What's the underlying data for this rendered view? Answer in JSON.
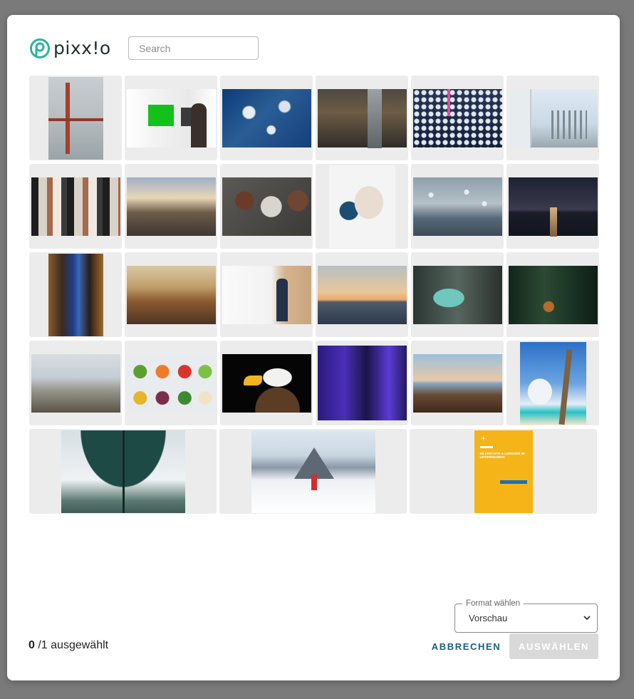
{
  "app": {
    "logo_text": "pixx!o",
    "brand_color": "#2bb3a0"
  },
  "search": {
    "placeholder": "Search",
    "value": ""
  },
  "gallery": {
    "rows": [
      [
        {
          "name": "golden-gate-bridge-fog",
          "orientation": "portrait"
        },
        {
          "name": "office-green-screen-workers",
          "orientation": "landscape"
        },
        {
          "name": "ocean-waves-aerial",
          "orientation": "landscape"
        },
        {
          "name": "factory-interior",
          "orientation": "landscape"
        },
        {
          "name": "lab-pipette-wells",
          "orientation": "landscape"
        },
        {
          "name": "refinery-tanks",
          "orientation": "landscape"
        }
      ],
      [
        {
          "name": "clothing-rack",
          "orientation": "landscape"
        },
        {
          "name": "town-square-sunset",
          "orientation": "landscape"
        },
        {
          "name": "food-plates-table",
          "orientation": "landscape"
        },
        {
          "name": "sweater-socks-flatlay",
          "orientation": "portrait"
        },
        {
          "name": "birds-over-water",
          "orientation": "landscape"
        },
        {
          "name": "night-pier-boathouse",
          "orientation": "landscape"
        }
      ],
      [
        {
          "name": "narrow-street-dusk",
          "orientation": "portrait"
        },
        {
          "name": "assembly-hall",
          "orientation": "landscape"
        },
        {
          "name": "whiteboard-presentation",
          "orientation": "landscape"
        },
        {
          "name": "lifeguard-tower-sunset",
          "orientation": "landscape"
        },
        {
          "name": "scooter-street",
          "orientation": "landscape"
        },
        {
          "name": "forest-sitting-woman",
          "orientation": "landscape"
        }
      ],
      [
        {
          "name": "pier-amusement-crowd",
          "orientation": "landscape"
        },
        {
          "name": "vegetable-bowls",
          "orientation": "landscape"
        },
        {
          "name": "bald-eagle",
          "orientation": "landscape"
        },
        {
          "name": "server-room-neon",
          "orientation": "landscape"
        },
        {
          "name": "boardwalk-sea",
          "orientation": "landscape"
        },
        {
          "name": "palm-hammock-beach",
          "orientation": "portrait"
        }
      ],
      [
        {
          "name": "under-bridge-view",
          "orientation": "landscape"
        },
        {
          "name": "mountain-hiker",
          "orientation": "landscape"
        },
        {
          "name": "ebook-cover-bildrechte",
          "orientation": "portrait"
        }
      ]
    ],
    "ebook_cover": {
      "title": "BILDRECHTE & LIZENZEN IM UNTERNEHMEN",
      "color": "#f5b417"
    }
  },
  "format": {
    "label": "Format wählen",
    "selected": "Vorschau"
  },
  "selection": {
    "count": "0",
    "total_text": "/1 ausgewählt"
  },
  "buttons": {
    "cancel": "ABBRECHEN",
    "select": "AUSWÄHLEN"
  }
}
